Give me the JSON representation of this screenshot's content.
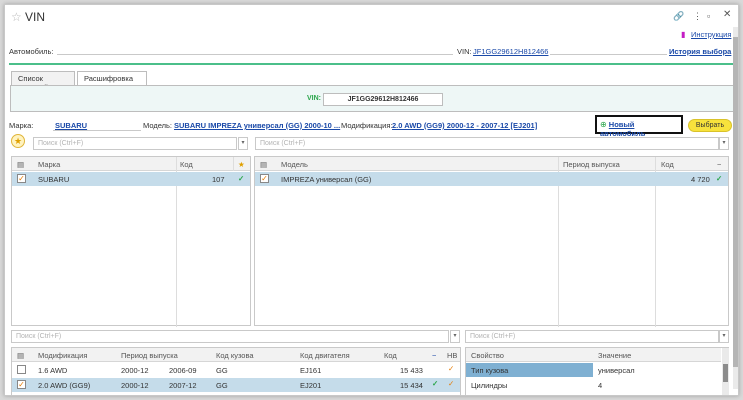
{
  "window": {
    "title": "VIN",
    "instructions_label": "Инструкция",
    "history_label": "История выбора"
  },
  "header": {
    "car_label": "Автомобиль:",
    "vin_label": "VIN:",
    "vin_value": "JF1GG29612H812466"
  },
  "tabs": [
    {
      "label": "Список моделей"
    },
    {
      "label": "Расшифровка VIN"
    }
  ],
  "vinpanel": {
    "label": "VIN:",
    "value": "JF1GG29612H812466"
  },
  "selection": {
    "brand_label": "Марка:",
    "brand_value": "SUBARU",
    "model_label": "Модель:",
    "model_value": "SUBARU IMPREZA универсал (GG) 2000-10 ...",
    "mod_label": "Модификация:",
    "mod_value": "2.0 AWD (GG9) 2000-12 - 2007-12 [EJ201]",
    "new_car_label": "Новый автомобиль",
    "select_label": "Выбрать"
  },
  "search": {
    "placeholder": "Поиск (Ctrl+F)"
  },
  "brands": {
    "headers": {
      "brand": "Марка",
      "code": "Код"
    },
    "rows": [
      {
        "name": "SUBARU",
        "code": "107"
      }
    ]
  },
  "models": {
    "headers": {
      "model": "Модель",
      "period": "Период выпуска",
      "code": "Код"
    },
    "rows": [
      {
        "name": "IMPREZA универсал (GG)",
        "code": "4 720"
      }
    ]
  },
  "mods": {
    "headers": {
      "mod": "Модификация",
      "period": "Период выпуска",
      "body": "Код кузова",
      "engine": "Код двигателя",
      "code": "Код",
      "nv": "НВ"
    },
    "rows": [
      {
        "name": "1.6 AWD",
        "from": "2000-12",
        "to": "2006-09",
        "body": "GG",
        "engine": "EJ161",
        "code": "15 433"
      },
      {
        "name": "2.0 AWD (GG9)",
        "from": "2000-12",
        "to": "2007-12",
        "body": "GG",
        "engine": "EJ201",
        "code": "15 434"
      }
    ]
  },
  "props": {
    "headers": {
      "prop": "Свойство",
      "value": "Значение"
    },
    "rows": [
      {
        "prop": "Тип кузова",
        "value": "универсал"
      },
      {
        "prop": "Цилиндры",
        "value": "4"
      }
    ]
  }
}
